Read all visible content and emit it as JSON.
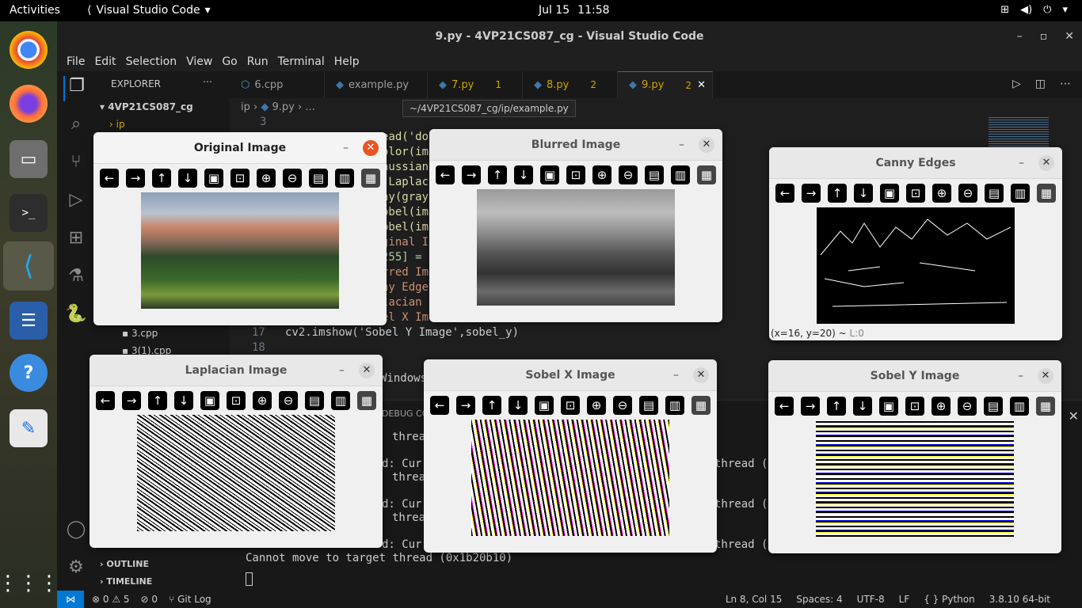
{
  "topbar": {
    "activities": "Activities",
    "app": "Visual Studio Code",
    "date": "Jul 15",
    "time": "11:58"
  },
  "window": {
    "title": "9.py - 4VP21CS087_cg - Visual Studio Code"
  },
  "menu": [
    "File",
    "Edit",
    "Selection",
    "View",
    "Go",
    "Run",
    "Terminal",
    "Help"
  ],
  "sidebar": {
    "header": "EXPLORER",
    "root": "4VP21CS087_cg",
    "folder": "ip",
    "files": [
      "3.cpp",
      "3(1).cpp"
    ],
    "outline": "OUTLINE",
    "timeline": "TIMELINE"
  },
  "tabs": [
    {
      "label": "6.cpp",
      "badge": ""
    },
    {
      "label": "example.py",
      "badge": ""
    },
    {
      "label": "7.py",
      "badge": "1"
    },
    {
      "label": "8.py",
      "badge": "2"
    },
    {
      "label": "9.py",
      "badge": "2"
    }
  ],
  "breadcrumb": {
    "folder": "ip",
    "file": "9.py",
    "rest": "..."
  },
  "tooltip": "~/4VP21CS087_cg/ip/example.py",
  "code": {
    "l3": "3",
    "frag1": "ead('do",
    "frag2": "olor(im",
    "frag3": "aussian",
    "frag4": ".Laplac",
    "frag5": "ny(gray",
    "frag6": "obel(im",
    "frag7": "obel(im",
    "frag8": "ginal I",
    "frag9": "255] =",
    "frag10": "rred Im",
    "frag11": "ny Edge",
    "frag12": "lacian",
    "frag13": "el X Im",
    "l17": "17",
    "line17": "cv2.imshow('Sobel Y Image',sobel_y)",
    "l18": "18",
    "frag14": "Windows"
  },
  "panel": {
    "tab": "DEBUG CO",
    "t1": "threa",
    "t2": "d: Curr",
    "t3": "threa",
    "t4": "d: Curr",
    "t5": "threa",
    "t6": "d: Curr",
    "r1": "thread (",
    "r2": "thread (",
    "r3": "thread (",
    "last": "Cannot move to target thread (0x1b20b10)"
  },
  "status": {
    "errors": "0",
    "warnings": "5",
    "info": "0",
    "git": "Git Log",
    "pos": "Ln 8, Col 15",
    "spaces": "Spaces: 4",
    "enc": "UTF-8",
    "eol": "LF",
    "lang": "Python",
    "ver": "3.8.10 64-bit"
  },
  "cvwindows": {
    "original": "Original Image",
    "blurred": "Blurred Image",
    "canny": "Canny Edges",
    "laplacian": "Laplacian Image",
    "sobelx": "Sobel X Image",
    "sobely": "Sobel Y Image",
    "canny_status": "(x=16, y=20) ~",
    "canny_level": "L:0"
  },
  "colors": {
    "accent": "#0078d4",
    "close_active": "#e95420",
    "warning": "#cca700"
  }
}
